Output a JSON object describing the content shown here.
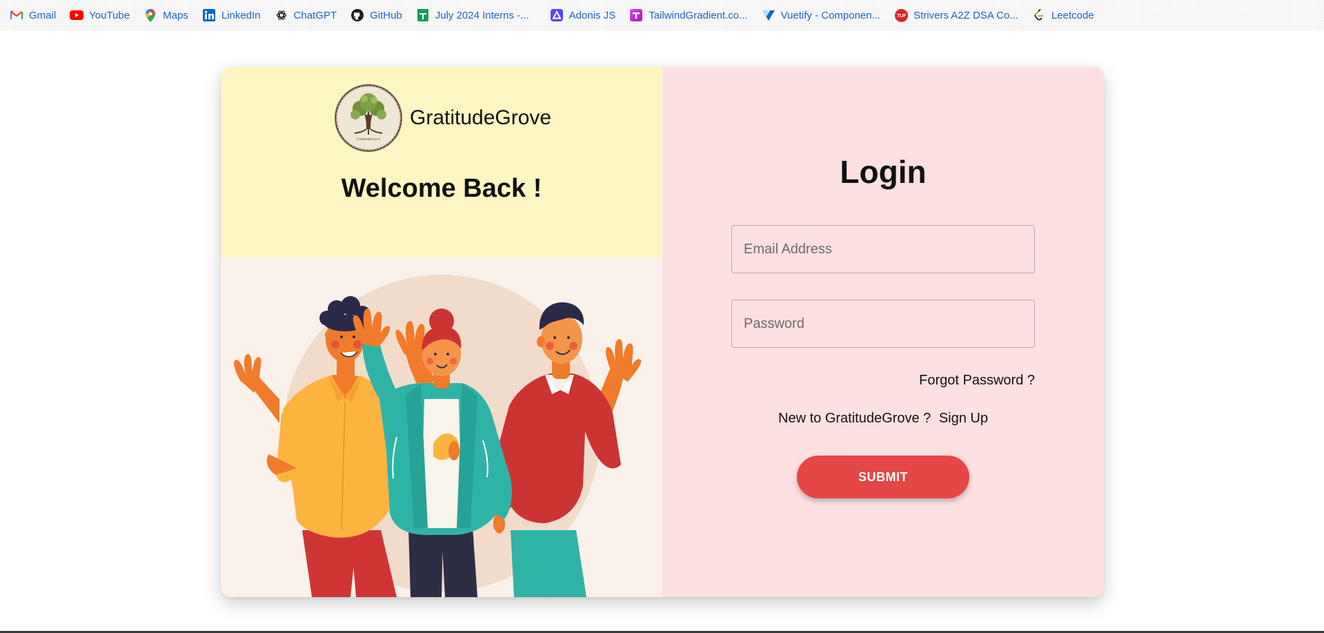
{
  "bookmarks": [
    {
      "label": "Gmail",
      "icon": "gmail-icon"
    },
    {
      "label": "YouTube",
      "icon": "youtube-icon"
    },
    {
      "label": "Maps",
      "icon": "maps-icon"
    },
    {
      "label": "LinkedIn",
      "icon": "linkedin-icon"
    },
    {
      "label": "ChatGPT",
      "icon": "chatgpt-icon"
    },
    {
      "label": "GitHub",
      "icon": "github-icon"
    },
    {
      "label": "July 2024 Interns -...",
      "icon": "sheets-icon"
    },
    {
      "label": "Adonis JS",
      "icon": "adonisjs-icon"
    },
    {
      "label": "TailwindGradient.co...",
      "icon": "tailwindgradient-icon"
    },
    {
      "label": "Vuetify - Componen...",
      "icon": "vuetify-icon"
    },
    {
      "label": "Strivers A2Z DSA Co...",
      "icon": "tuf-icon"
    },
    {
      "label": "Leetcode",
      "icon": "leetcode-icon"
    }
  ],
  "brand": {
    "name": "GratitudeGrove",
    "logo_text": "GratitudeGrove"
  },
  "welcome": "Welcome Back !",
  "login": {
    "title": "Login",
    "email_placeholder": "Email Address",
    "password_placeholder": "Password",
    "forgot": "Forgot Password ?",
    "signup_prompt": "New to GratitudeGrove ?",
    "signup_link": "Sign Up",
    "submit": "SUBMIT"
  },
  "colors": {
    "left_top_bg": "#fdf6c3",
    "left_bottom_bg": "#faf1ea",
    "right_bg": "#fde0e1",
    "submit_bg": "#e54646",
    "bookmark_text": "#1f63c7"
  }
}
